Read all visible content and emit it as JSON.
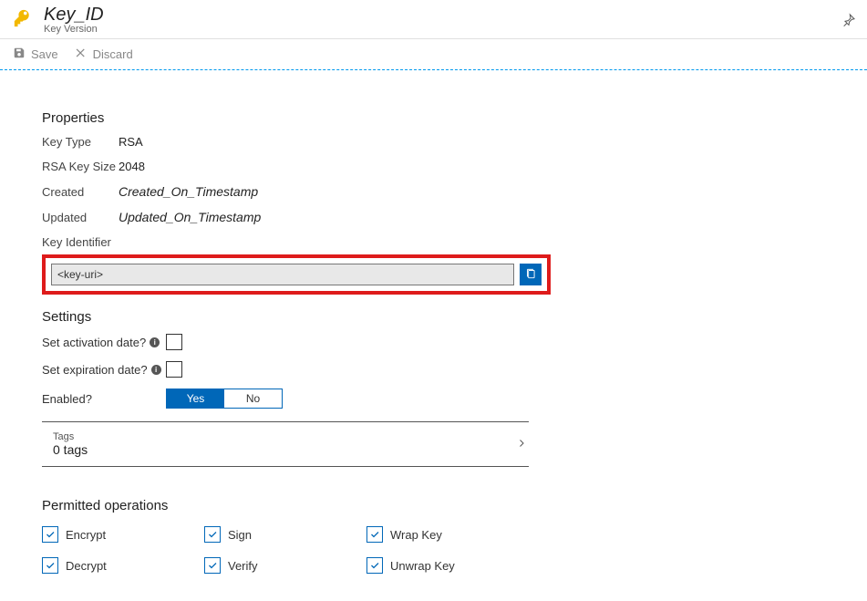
{
  "header": {
    "title": "Key_ID",
    "subtitle": "Key Version"
  },
  "toolbar": {
    "save_label": "Save",
    "discard_label": "Discard"
  },
  "properties": {
    "heading": "Properties",
    "items": [
      {
        "label": "Key Type",
        "value": "RSA",
        "italic": false
      },
      {
        "label": "RSA Key Size",
        "value": "2048",
        "italic": false
      },
      {
        "label": "Created",
        "value": "Created_On_Timestamp",
        "italic": true
      },
      {
        "label": "Updated",
        "value": "Updated_On_Timestamp",
        "italic": true
      }
    ],
    "key_identifier_label": "Key Identifier",
    "key_uri_value": "<key-uri>"
  },
  "settings": {
    "heading": "Settings",
    "activation_label": "Set activation date?",
    "expiration_label": "Set expiration date?",
    "enabled_label": "Enabled?",
    "enabled_yes": "Yes",
    "enabled_no": "No"
  },
  "tags": {
    "label": "Tags",
    "count": "0 tags"
  },
  "permitted": {
    "heading": "Permitted operations",
    "ops": [
      {
        "label": "Encrypt"
      },
      {
        "label": "Sign"
      },
      {
        "label": "Wrap Key"
      },
      {
        "label": "Decrypt"
      },
      {
        "label": "Verify"
      },
      {
        "label": "Unwrap Key"
      }
    ]
  }
}
